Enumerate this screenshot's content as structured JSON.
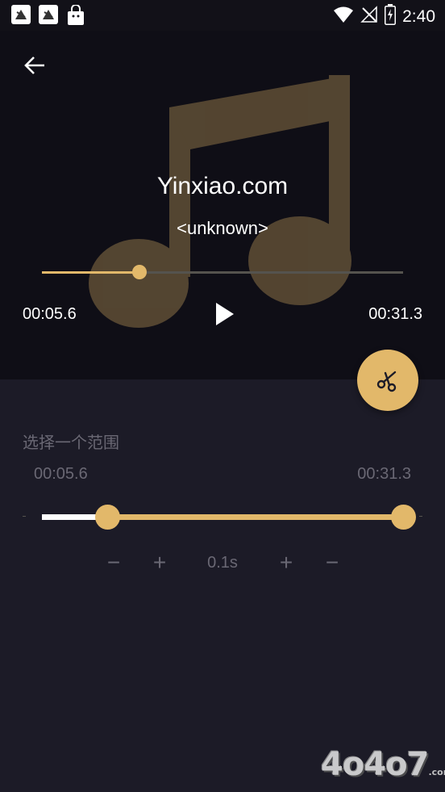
{
  "status_bar": {
    "time": "2:40",
    "icons": [
      "app-notification-icon",
      "app-notification-icon",
      "shopping-bag-icon",
      "wifi-icon",
      "no-signal-icon",
      "battery-charging-icon"
    ]
  },
  "player": {
    "title": "Yinxiao.com",
    "artist": "<unknown>",
    "current_time": "00:05.6",
    "total_time": "00:31.3",
    "progress_percent": 27,
    "album_art_icon": "music-note-icon"
  },
  "trim": {
    "section_label": "选择一个范围",
    "start_time": "00:05.6",
    "end_time": "00:31.3",
    "start_percent": 18,
    "end_percent": 100,
    "step_value": "0.1s",
    "buttons": {
      "left_minus": "−",
      "left_plus": "+",
      "right_plus": "+",
      "right_minus": "−"
    }
  },
  "watermark": {
    "text": "4o4o7",
    "suffix": ".com"
  },
  "colors": {
    "accent": "#e2b86a",
    "player_bg": "#0f0e16",
    "panel_bg": "#1c1b27",
    "muted_text": "#6a6874"
  }
}
